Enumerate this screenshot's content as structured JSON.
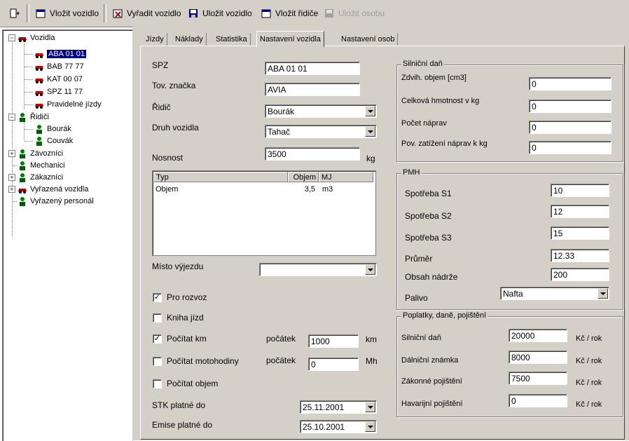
{
  "toolbar": {
    "items": [
      {
        "label": "",
        "icon": "exit-icon"
      },
      {
        "label": "Vložit vozidlo",
        "icon": "insert-icon"
      },
      {
        "label": "Vyřadit vozidlo",
        "icon": "remove-icon"
      },
      {
        "label": "Uložit vozidlo",
        "icon": "save-icon"
      },
      {
        "label": "Vložit řidiče",
        "icon": "insert-icon"
      },
      {
        "label": "Uložit osobu",
        "icon": "save-icon",
        "disabled": true
      }
    ]
  },
  "tree": {
    "vozidla": "Vozidla",
    "vehicles": [
      "ABA 01 01",
      "BAB 77 77",
      "KAT 00 07",
      "SPZ 11 77",
      "Pravidelné jízdy"
    ],
    "ridici": "Řidiči",
    "drivers": [
      "Bourák",
      "Couvák"
    ],
    "zavoznici": "Závozníci",
    "mechanici": "Mechanici",
    "zakaznici": "Zákazníci",
    "vyrazena_vozidla": "Vyřazená vozidla",
    "vyrazeny_personal": "Vyřazený personál"
  },
  "tabs": [
    "Jízdy",
    "Náklady",
    "Statistika",
    "Nastavení vozidla",
    "Nastavení osob"
  ],
  "form": {
    "spz_label": "SPZ",
    "spz": "ABA 01 01",
    "znacka_label": "Tov. značka",
    "znacka": "AVIA",
    "ridic_label": "Řidič",
    "ridic": "Bourák",
    "druh_label": "Druh vozidla",
    "druh": "Tahač",
    "nosnost_label": "Nosnost",
    "nosnost": "3500",
    "nosnost_unit": "kg",
    "grid_headers": [
      "Typ",
      "Objem",
      "MJ"
    ],
    "grid_row": [
      "Objem",
      "3,5",
      "m3"
    ],
    "misto_label": "Místo výjezdu",
    "misto": "",
    "pro_rozvoz": "Pro rozvoz",
    "kniha_jizd": "Kniha jízd",
    "pocitat_km": "Počítat km",
    "pocatek_label": "počátek",
    "km_start": "1000",
    "km_unit": "km",
    "pocitat_moto": "Počítat motohodiny",
    "moto_start": "0",
    "moto_unit": "Mh",
    "pocitat_objem": "Počítat objem",
    "stk_label": "STK platné do",
    "stk": "25.11.2001",
    "emise_label": "Emise platné do",
    "emise": "25.10.2001"
  },
  "checks": {
    "pro_rozvoz": true,
    "kniha_jizd": false,
    "pocitat_km": true,
    "pocitat_moto": false,
    "pocitat_objem": false
  },
  "silnicni_dan": {
    "title": "Silniční daň",
    "objem_label": "Zdvih. objem [cm3]",
    "objem": "0",
    "hmotnost_label": "Celková hmotnost v kg",
    "hmotnost": "0",
    "napravy_label": "Počet náprav",
    "napravy": "0",
    "zatizeni_label": "Pov. zatížení náprav k kg",
    "zatizeni": "0"
  },
  "pmh": {
    "title": "PMH",
    "s1_label": "Spotřeba S1",
    "s1": "10",
    "s2_label": "Spotřeba S2",
    "s2": "12",
    "s3_label": "Spotřeba S3",
    "s3": "15",
    "prumer_label": "Průměr",
    "prumer": "12.33",
    "obsah_label": "Obsah nádrže",
    "obsah": "200",
    "palivo_label": "Palivo",
    "palivo": "Nafta"
  },
  "poplatky": {
    "title": "Poplatky, daně, pojištění",
    "unit": "Kč / rok",
    "rows": [
      {
        "label": "Silniční daň",
        "value": "20000"
      },
      {
        "label": "Dálniční známka",
        "value": "8000"
      },
      {
        "label": "Zákonné pojištění",
        "value": "7500"
      },
      {
        "label": "Havarijní pojištění",
        "value": "0"
      }
    ]
  },
  "colors": {
    "selection": "#000080",
    "face": "#d4d0c8"
  }
}
